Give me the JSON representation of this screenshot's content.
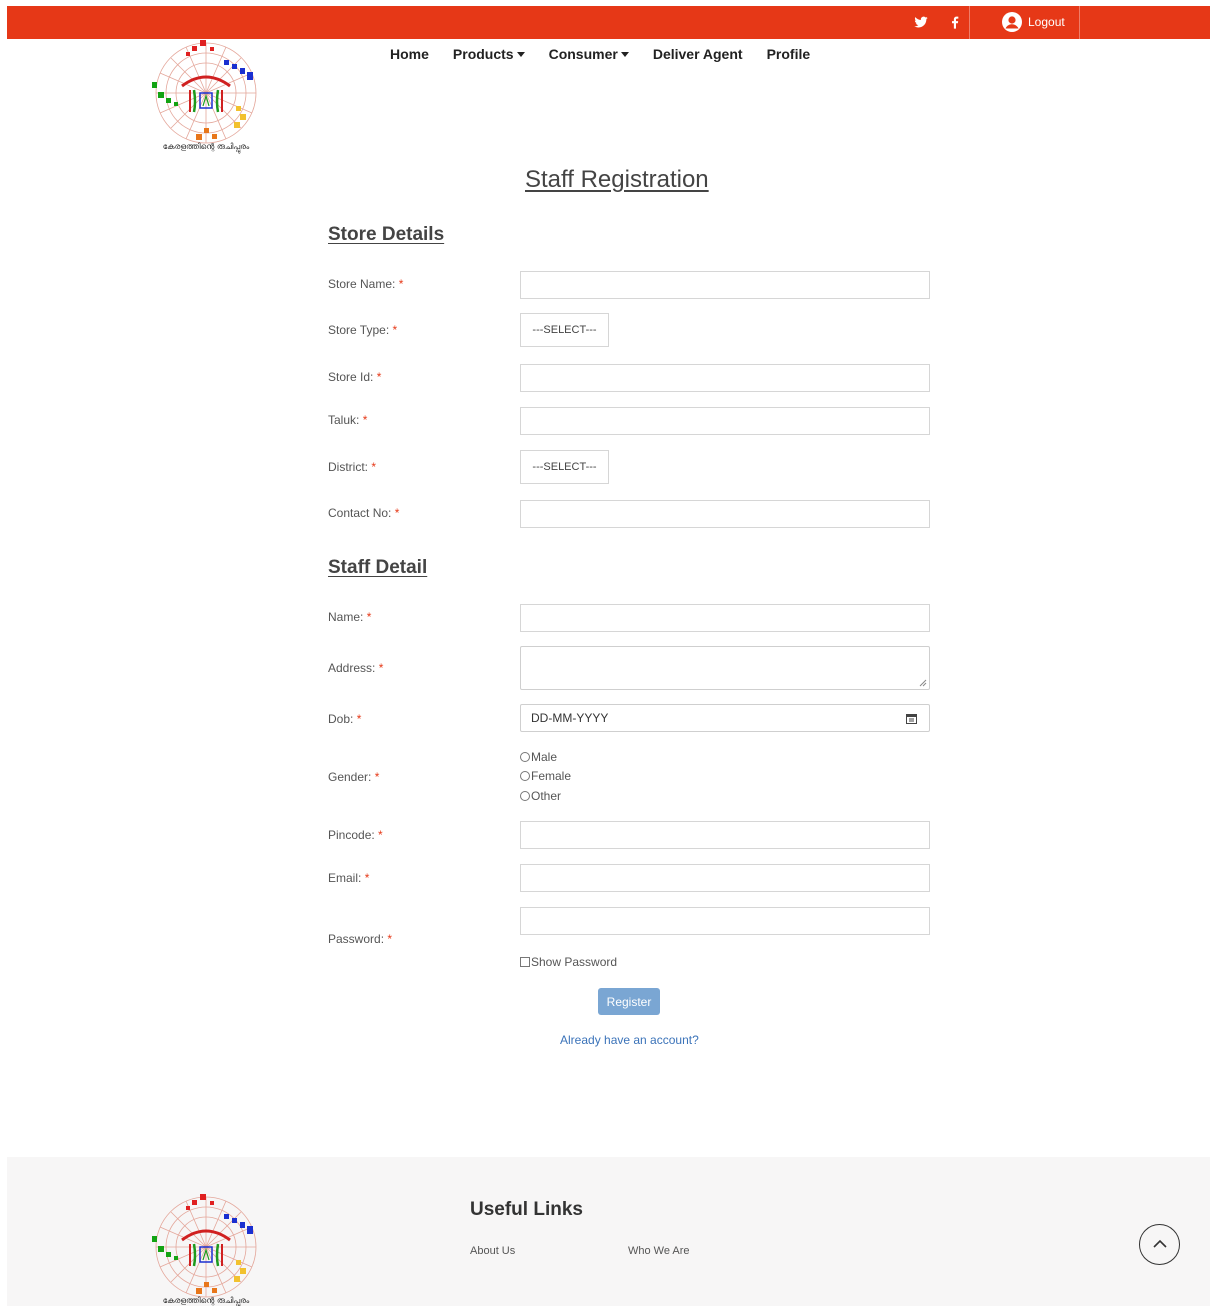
{
  "topbar": {
    "accent": "#e63817",
    "social": [
      "twitter-icon",
      "facebook-icon"
    ],
    "logout_label": "Logout"
  },
  "logo": {
    "caption": "കേരളത്തിന്റെ രുചിപ്പുരം"
  },
  "nav": {
    "home": "Home",
    "products": "Products",
    "consumer": "Consumer",
    "deliver_agent": "Deliver Agent",
    "profile": "Profile"
  },
  "page": {
    "title": "Staff Registration"
  },
  "store_section": {
    "title": "Store Details",
    "store_name_label": "Store Name:",
    "store_type_label": "Store Type:",
    "store_type_value": "---SELECT---",
    "store_id_label": "Store Id:",
    "taluk_label": "Taluk:",
    "district_label": "District:",
    "district_value": "---SELECT---",
    "contact_label": "Contact No:"
  },
  "staff_section": {
    "title": "Staff Detail",
    "name_label": "Name:",
    "address_label": "Address:",
    "dob_label": "Dob:",
    "dob_placeholder": "DD-MM-YYYY",
    "gender_label": "Gender:",
    "gender_options": [
      "Male",
      "Female",
      "Other"
    ],
    "pincode_label": "Pincode:",
    "email_label": "Email:",
    "password_label": "Password:",
    "show_password": "Show Password"
  },
  "required_mark": "*",
  "register_label": "Register",
  "login_link": "Already have an account?",
  "footer": {
    "heading": "Useful Links",
    "links": [
      "About Us",
      "Who We Are"
    ]
  }
}
